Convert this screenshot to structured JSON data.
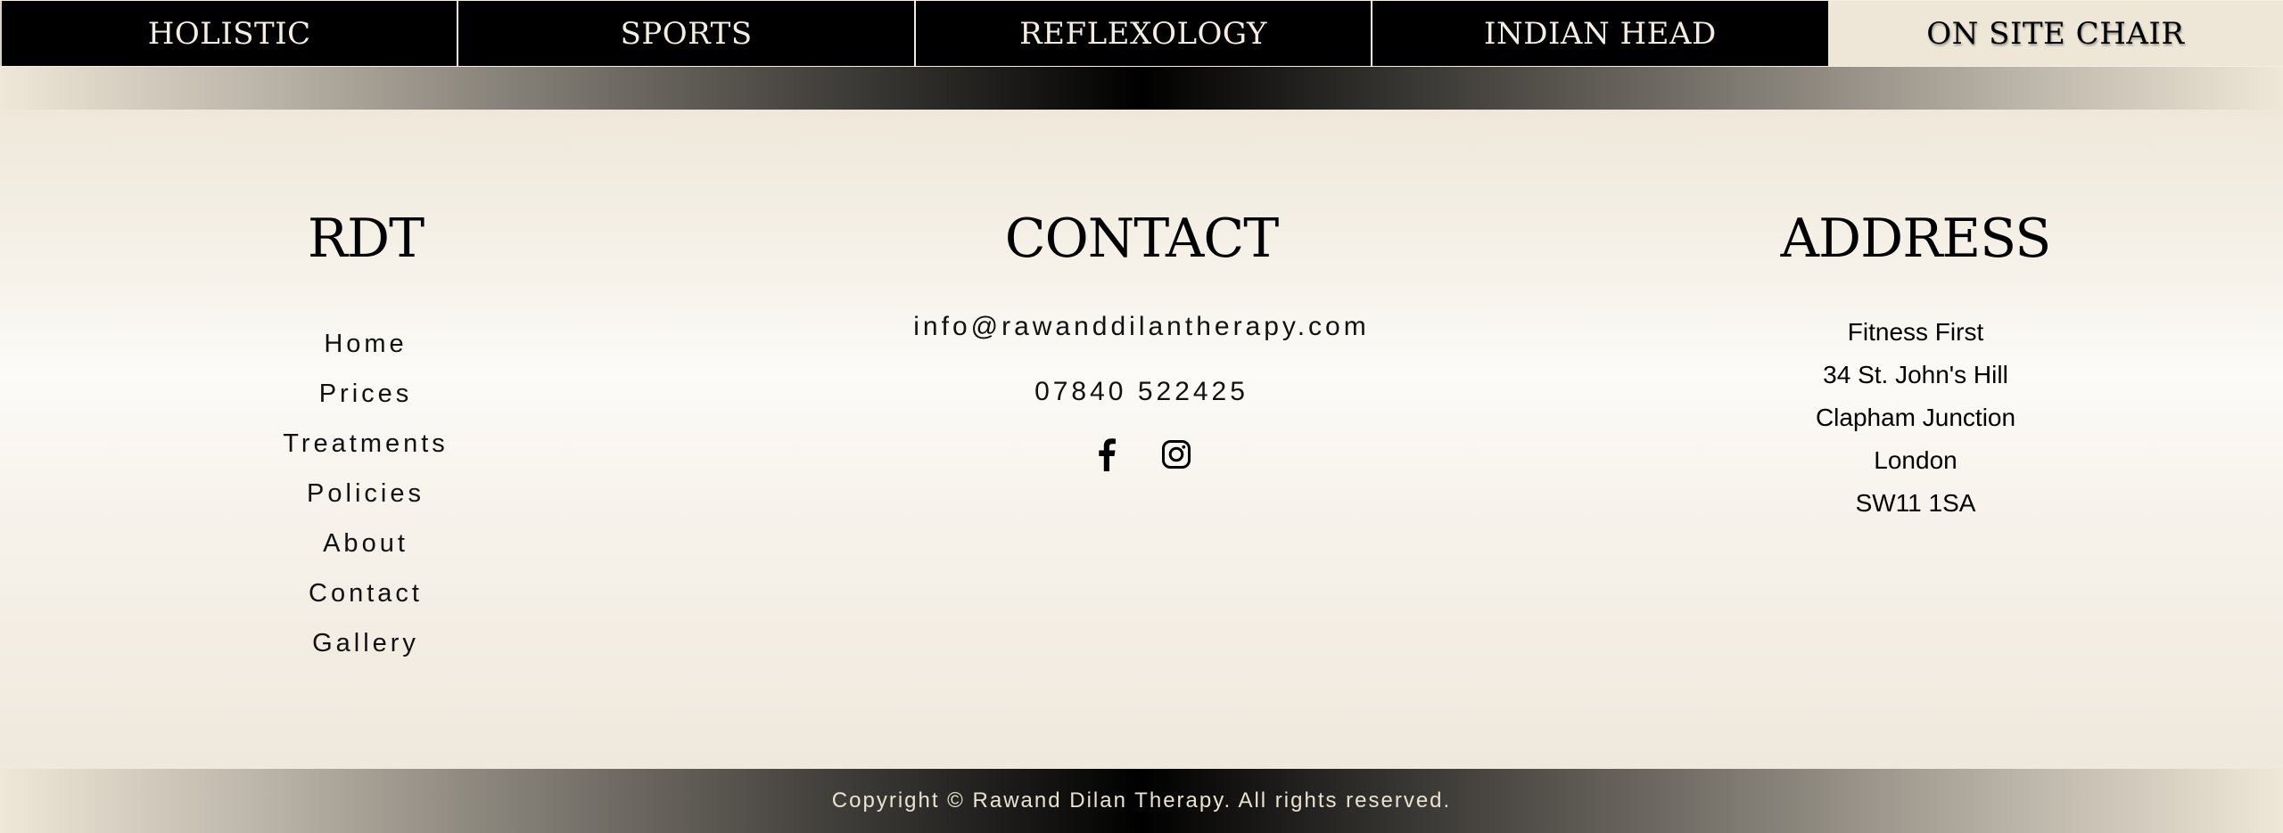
{
  "tabs": [
    {
      "label": "HOLISTIC"
    },
    {
      "label": "SPORTS"
    },
    {
      "label": "REFLEXOLOGY"
    },
    {
      "label": "INDIAN HEAD"
    },
    {
      "label": "ON SITE CHAIR"
    }
  ],
  "footer": {
    "rdt": {
      "title": "RDT",
      "links": [
        "Home",
        "Prices",
        "Treatments",
        "Policies",
        "About",
        "Contact",
        "Gallery"
      ]
    },
    "contact": {
      "title": "CONTACT",
      "email": "info@rawanddilantherapy.com",
      "phone": "07840 522425",
      "social": [
        "facebook-icon",
        "instagram-icon"
      ]
    },
    "address": {
      "title": "ADDRESS",
      "lines": [
        "Fitness First",
        "34 St. John's Hill",
        "Clapham Junction",
        "London",
        "SW11 1SA"
      ]
    },
    "copyright": "Copyright © Rawand Dilan Therapy. All rights reserved."
  },
  "colors": {
    "tab_bg": "#000000",
    "tab_text": "#f3ede2",
    "active_tab_bg": "#eee7d7",
    "page_bg": "#f3ede2"
  }
}
